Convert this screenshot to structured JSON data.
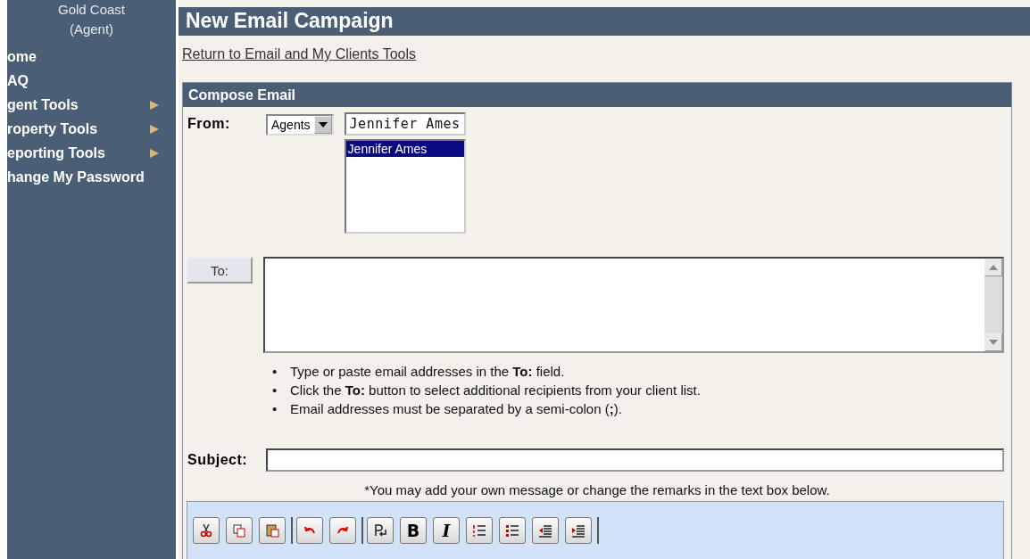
{
  "sidebar": {
    "office": "Gold Coast",
    "role": "(Agent)",
    "items": [
      {
        "label": "ome",
        "submenu": false
      },
      {
        "label": "AQ",
        "submenu": false
      },
      {
        "label": "gent Tools",
        "submenu": true
      },
      {
        "label": "roperty Tools",
        "submenu": true
      },
      {
        "label": "eporting Tools",
        "submenu": true
      },
      {
        "label": "hange My Password",
        "submenu": false
      }
    ]
  },
  "page_title": "New Email Campaign",
  "return_link": "Return to Email and My Clients Tools",
  "compose": {
    "title": "Compose Email",
    "from_label": "From:",
    "from_type": "Agents",
    "from_search": "Jennifer Ames",
    "from_list": [
      {
        "label": "Jennifer Ames",
        "selected": true
      }
    ],
    "to_button": "To:",
    "hints": [
      {
        "bullet": "•",
        "text": "Type or paste email addresses in the **To:** field."
      },
      {
        "bullet": "•",
        "text": "Click the **To:** button to select additional recipients from your client list."
      },
      {
        "bullet": "•",
        "text": "Email addresses must be separated by a semi-colon (**;**)."
      }
    ],
    "subject_label": "Subject:",
    "note": "*You may add your own message or change the remarks in the text box below.",
    "toolbar": [
      [
        {
          "kind": "cut"
        },
        {
          "kind": "copy"
        },
        {
          "kind": "paste"
        }
      ],
      [
        {
          "kind": "undo"
        },
        {
          "kind": "redo"
        }
      ],
      [
        {
          "kind": "break"
        },
        {
          "kind": "bold",
          "label": "B"
        },
        {
          "kind": "italic",
          "label": "I"
        },
        {
          "kind": "ordered"
        },
        {
          "kind": "bullets"
        },
        {
          "kind": "outdent"
        },
        {
          "kind": "indent"
        }
      ]
    ]
  }
}
